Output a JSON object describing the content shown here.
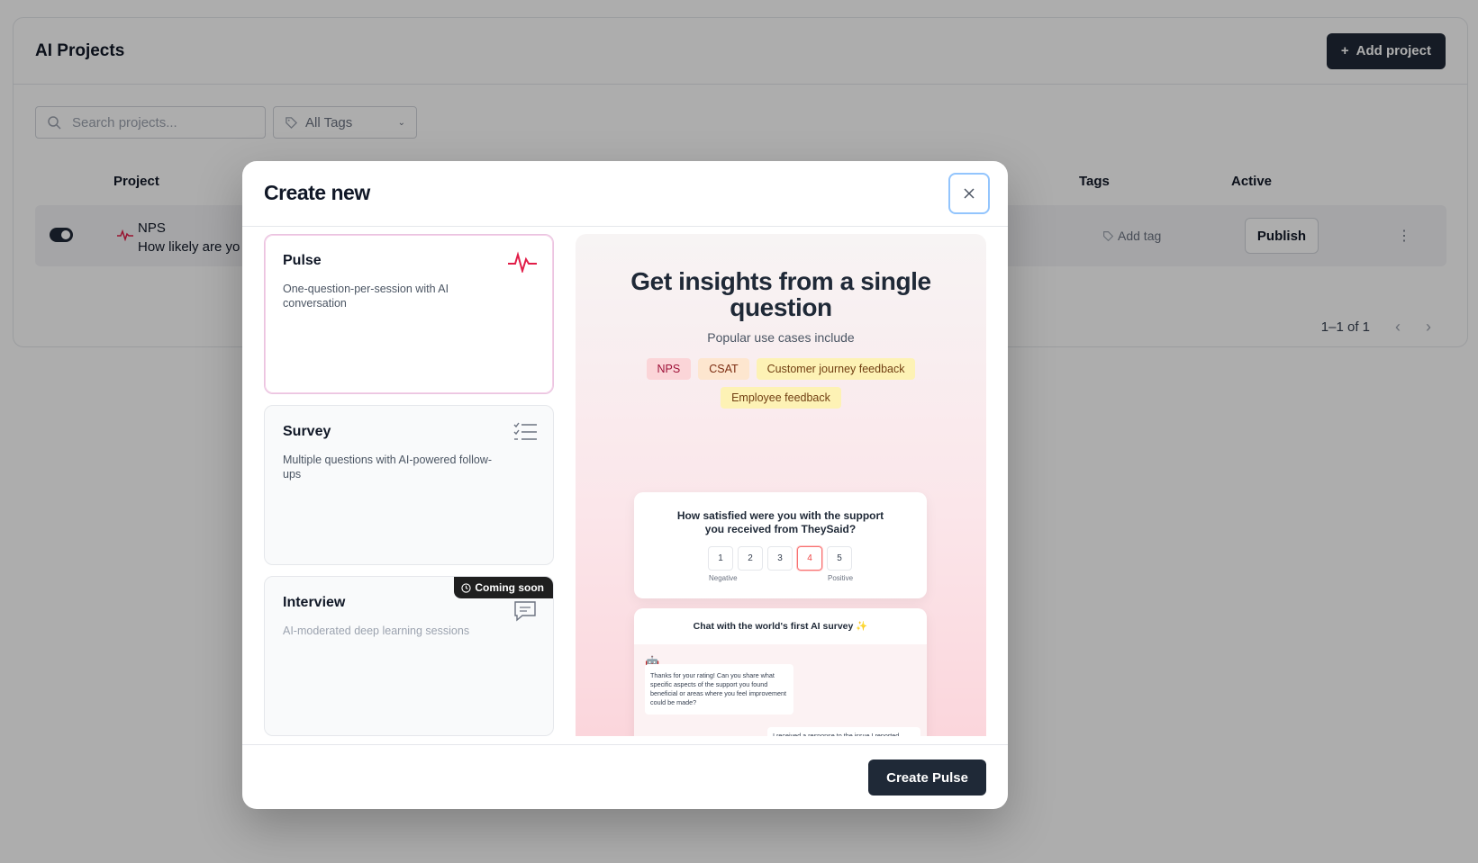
{
  "page": {
    "title": "AI Projects",
    "add_project_label": "Add project",
    "search_placeholder": "Search projects...",
    "tags_filter_label": "All Tags",
    "columns": {
      "project": "Project",
      "tags": "Tags",
      "active": "Active"
    },
    "rows": [
      {
        "name": "NPS",
        "description": "How likely are yo",
        "add_tag_label": "Add tag",
        "publish_label": "Publish"
      }
    ],
    "pagination": "1–1 of 1"
  },
  "modal": {
    "title": "Create new",
    "types": [
      {
        "name": "Pulse",
        "description": "One-question-per-session with AI conversation",
        "icon": "pulse-icon",
        "selected": true
      },
      {
        "name": "Survey",
        "description": "Multiple questions with AI-powered follow-ups",
        "icon": "checklist-icon"
      },
      {
        "name": "Interview",
        "description": "AI-moderated deep learning sessions",
        "icon": "chat-icon",
        "badge": "Coming soon"
      }
    ],
    "preview": {
      "headline": "Get insights from a single question",
      "subtitle": "Popular use cases include",
      "chips": [
        "NPS",
        "CSAT",
        "Customer journey feedback",
        "Employee feedback"
      ],
      "rating_question": "How satisfied were you with the support you received from TheySaid?",
      "scale": [
        "1",
        "2",
        "3",
        "4",
        "5"
      ],
      "selected_score": "4",
      "scale_low": "Negative",
      "scale_high": "Positive",
      "chat_title": "Chat with the world's first AI survey ✨",
      "bot_message": "Thanks for your rating! Can you share what specific aspects of the support you found beneficial or areas where you feel improvement could be made?",
      "user_message": "I received a response to the issue I reported"
    },
    "create_label": "Create Pulse"
  },
  "colors": {
    "accent": "#1f2937",
    "pulse": "#e11d48",
    "focus_ring": "#93c5fd"
  }
}
